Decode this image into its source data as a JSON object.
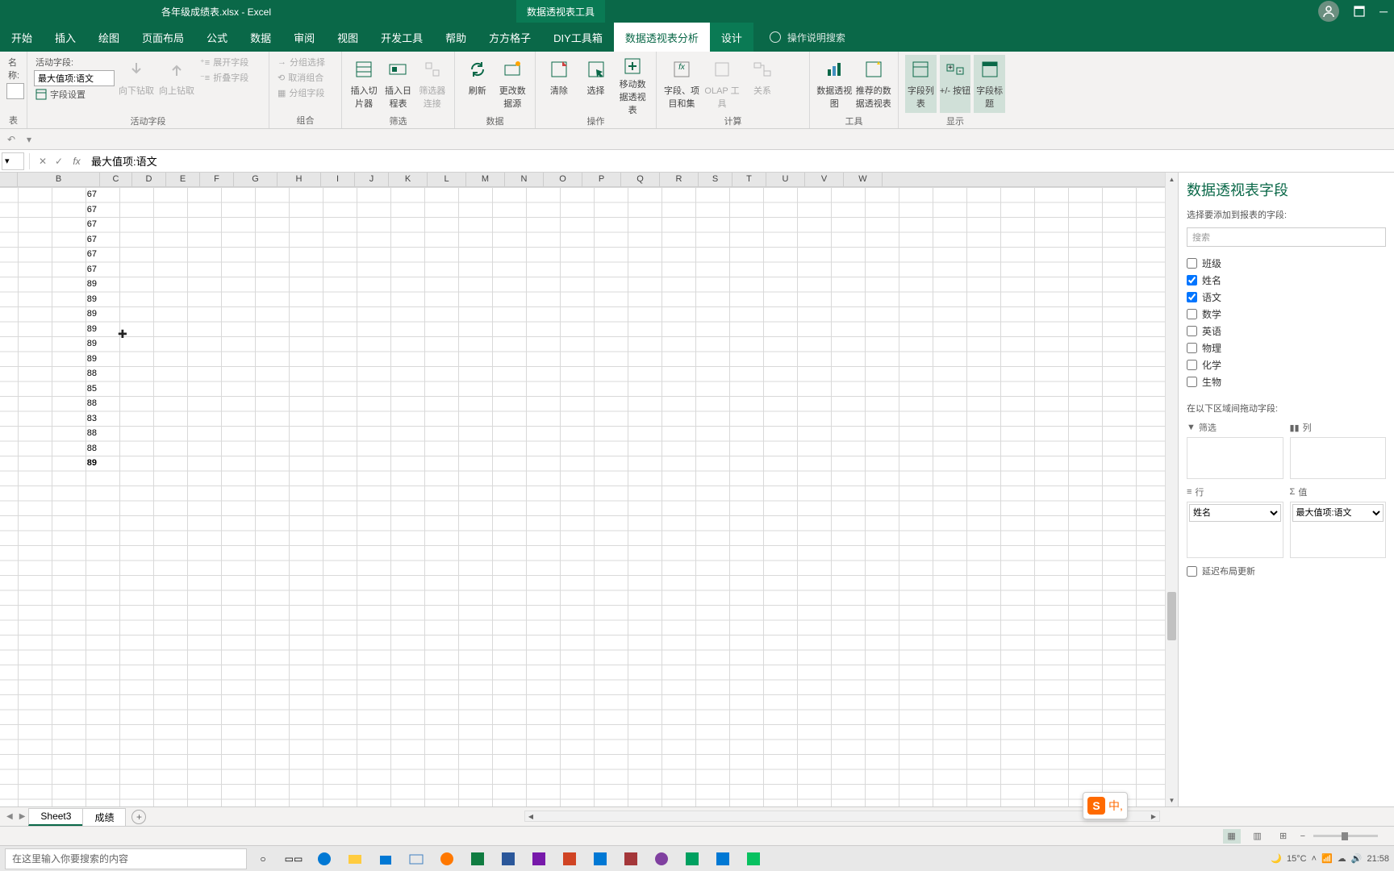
{
  "title_bar": {
    "file_title": "各年级成绩表.xlsx - Excel",
    "context_tool": "数据透视表工具"
  },
  "ribbon_tabs": [
    "开始",
    "插入",
    "绘图",
    "页面布局",
    "公式",
    "数据",
    "审阅",
    "视图",
    "开发工具",
    "帮助",
    "方方格子",
    "DIY工具箱",
    "数据透视表分析",
    "设计"
  ],
  "active_tab_index": 12,
  "tell_me": "操作说明搜索",
  "ribbon": {
    "active_field": {
      "label": "活动字段:",
      "value": "最大值项:语文",
      "settings": "字段设置",
      "drill_down": "向下钻取",
      "drill_up": "向上钻取",
      "expand": "展开字段",
      "collapse": "折叠字段",
      "group_label": "活动字段"
    },
    "name_label": "名称:",
    "group": {
      "sel": "分组选择",
      "cancel": "取消组合",
      "field": "分组字段",
      "label": "组合"
    },
    "filter": {
      "slicer": "插入切片器",
      "timeline": "插入日程表",
      "conn": "筛选器连接",
      "label": "筛选"
    },
    "data": {
      "refresh": "刷新",
      "change": "更改数据源",
      "label": "数据"
    },
    "actions": {
      "clear": "清除",
      "select": "选择",
      "move": "移动数据透视表",
      "label": "操作"
    },
    "calc": {
      "fields": "字段、项目和集",
      "olap": "OLAP 工具",
      "relations": "关系",
      "label": "计算"
    },
    "tools": {
      "chart": "数据透视图",
      "recommend": "推荐的数据透视表",
      "label": "工具"
    },
    "show": {
      "list": "字段列表",
      "buttons": "+/- 按钮",
      "headers": "字段标题",
      "label": "显示"
    }
  },
  "formula_bar": {
    "value": "最大值项:语文"
  },
  "columns": [
    "B",
    "C",
    "D",
    "E",
    "F",
    "G",
    "H",
    "I",
    "J",
    "K",
    "L",
    "M",
    "N",
    "O",
    "P",
    "Q",
    "R",
    "S",
    "T",
    "U",
    "V",
    "W"
  ],
  "col_b_values": [
    67,
    67,
    67,
    67,
    67,
    67,
    89,
    89,
    89,
    89,
    89,
    89,
    88,
    85,
    88,
    83,
    88,
    88,
    89
  ],
  "cursor_cell": {
    "col": "C",
    "row_index": 9
  },
  "field_pane": {
    "title": "数据透视表字段",
    "subtitle": "选择要添加到报表的字段:",
    "search_placeholder": "搜索",
    "fields": [
      {
        "name": "班级",
        "checked": false
      },
      {
        "name": "姓名",
        "checked": true
      },
      {
        "name": "语文",
        "checked": true
      },
      {
        "name": "数学",
        "checked": false
      },
      {
        "name": "英语",
        "checked": false
      },
      {
        "name": "物理",
        "checked": false
      },
      {
        "name": "化学",
        "checked": false
      },
      {
        "name": "生物",
        "checked": false
      }
    ],
    "drag_label": "在以下区域间拖动字段:",
    "areas": {
      "filter": "筛选",
      "columns": "列",
      "rows": "行",
      "values": "值",
      "row_field": "姓名",
      "value_field": "最大值项:语文"
    },
    "defer": "延迟布局更新"
  },
  "sheet_tabs": {
    "active": "Sheet3",
    "tabs": [
      "Sheet3",
      "成绩"
    ]
  },
  "taskbar": {
    "search": "在这里输入你要搜索的内容",
    "temp": "15°C",
    "time": "21:58"
  },
  "ime": "中"
}
